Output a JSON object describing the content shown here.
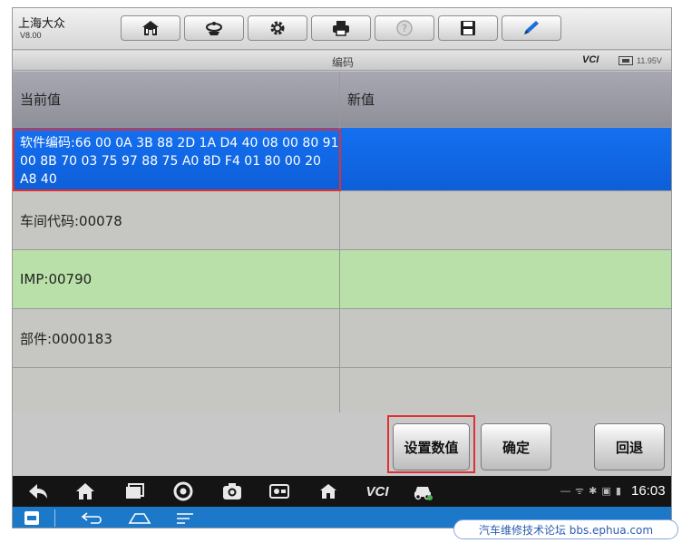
{
  "app": {
    "title": "上海大众",
    "version": "V8.00"
  },
  "toolbar": {
    "buttons": [
      {
        "name": "home-button",
        "icon": "home-icon"
      },
      {
        "name": "vehicle-swap-button",
        "icon": "car-swap-icon"
      },
      {
        "name": "settings-button",
        "icon": "gear-icon"
      },
      {
        "name": "print-button",
        "icon": "printer-icon"
      },
      {
        "name": "help-button",
        "icon": "help-icon",
        "disabled": true
      },
      {
        "name": "save-button",
        "icon": "save-icon"
      },
      {
        "name": "edit-button",
        "icon": "pencil-icon"
      }
    ]
  },
  "subtitle": {
    "title": "编码",
    "vci": "VCI",
    "voltage": "11.95V"
  },
  "table": {
    "headers": [
      "当前值",
      "新值"
    ],
    "rows": [
      {
        "current": "软件编码:66 00 0A 3B 88 2D 1A D4 40 08 00 80 91 00 8B 70 03 75 97 88 75 A0 8D F4 01 80 00 20 A8 40",
        "new": "",
        "state": "selected"
      },
      {
        "current": "车间代码:00078",
        "new": "",
        "state": "normal"
      },
      {
        "current": "IMP:00790",
        "new": "",
        "state": "highlighted"
      },
      {
        "current": "部件:0000183",
        "new": "",
        "state": "normal"
      }
    ]
  },
  "actions": {
    "set_value": "设置数值",
    "confirm": "确定",
    "back": "回退"
  },
  "navbar": {
    "vci": "VCI",
    "clock": "16:03",
    "status": "— ᯤ ✱ ▣ ▮"
  },
  "colors": {
    "selected_row": "#1470f0",
    "highlighted_row": "#b9e0a8",
    "highlight_box": "#e03030",
    "system_bar": "#1c78c8"
  },
  "watermark": "汽车维修技术论坛 bbs.ephua.com"
}
